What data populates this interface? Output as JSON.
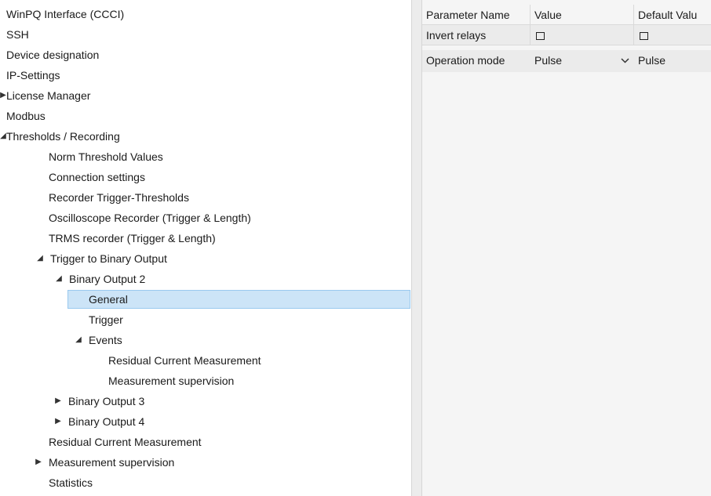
{
  "tree": {
    "items": [
      {
        "label": "WinPQ Interface (CCCI)",
        "expander": ""
      },
      {
        "label": "SSH",
        "expander": ""
      },
      {
        "label": "Device designation",
        "expander": ""
      },
      {
        "label": "IP-Settings",
        "expander": ""
      },
      {
        "label": "License Manager",
        "expander": "▶"
      },
      {
        "label": "Modbus",
        "expander": ""
      },
      {
        "label": "Thresholds / Recording",
        "expander": "◢"
      },
      {
        "label": "Norm Threshold Values",
        "expander": ""
      },
      {
        "label": "Connection settings",
        "expander": ""
      },
      {
        "label": "Recorder Trigger-Thresholds",
        "expander": ""
      },
      {
        "label": "Oscilloscope Recorder (Trigger & Length)",
        "expander": ""
      },
      {
        "label": "TRMS recorder (Trigger & Length)",
        "expander": ""
      },
      {
        "label": "Trigger to Binary Output",
        "expander": "◢"
      },
      {
        "label": "Binary Output 2",
        "expander": "◢"
      },
      {
        "label": "General",
        "expander": "",
        "selected": true
      },
      {
        "label": "Trigger",
        "expander": ""
      },
      {
        "label": "Events",
        "expander": "◢"
      },
      {
        "label": "Residual Current Measurement",
        "expander": ""
      },
      {
        "label": "Measurement supervision",
        "expander": ""
      },
      {
        "label": "Binary Output 3",
        "expander": "▶"
      },
      {
        "label": "Binary Output 4",
        "expander": "▶"
      },
      {
        "label": "Residual Current Measurement",
        "expander": ""
      },
      {
        "label": "Measurement supervision",
        "expander": "▶"
      },
      {
        "label": "Statistics",
        "expander": ""
      }
    ]
  },
  "grid": {
    "headers": [
      "Parameter Name",
      "Value",
      "Default Valu"
    ],
    "rows": [
      {
        "name": "Invert relays",
        "value_checked": false,
        "default_checked": false
      },
      {
        "name": "Operation mode",
        "value": "Pulse",
        "default": "Pulse"
      }
    ],
    "dropdown_icon": "chevron-down-icon"
  }
}
